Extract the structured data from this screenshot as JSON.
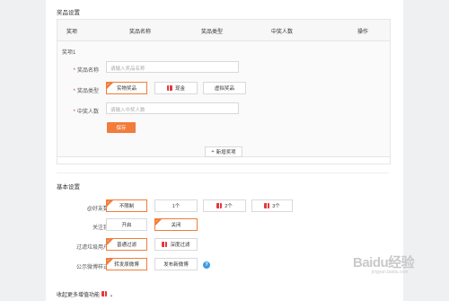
{
  "prize_section": {
    "title": "奖品设置",
    "columns": [
      "奖项",
      "奖品名称",
      "奖品类型",
      "中奖人数",
      "操作"
    ],
    "prize_label": "奖项1",
    "name_label": "奖品名称",
    "name_placeholder": "请输入奖品名称",
    "type_label": "奖品类型",
    "types": [
      "实物奖品",
      "现金",
      "虚拟奖品"
    ],
    "count_label": "中奖人数",
    "count_placeholder": "请输入中奖人数",
    "save": "保存",
    "add": "新增奖项",
    "required_mark": "*"
  },
  "basic_section": {
    "title": "基本设置",
    "friends_label": "@好友数",
    "friends_options": [
      "不限制",
      "1个",
      "2个",
      "3个"
    ],
    "follow_label": "关注我",
    "follow_options": [
      "开启",
      "关闭"
    ],
    "filter_label": "过滤垃圾用户",
    "filter_options": [
      "普通过滤",
      "深度过滤"
    ],
    "publish_label": "公示微博样式",
    "publish_options": [
      "转发原微博",
      "发布新微博"
    ],
    "help": "?"
  },
  "more": {
    "label": "收起更多增值功能",
    "toggle": "▲"
  },
  "watermark": {
    "brand": "Baidu经验",
    "url": "jingyan.baidu.com"
  },
  "colors": {
    "accent": "#f27c3a",
    "red": "#e4393c",
    "help": "#3c9be8"
  }
}
